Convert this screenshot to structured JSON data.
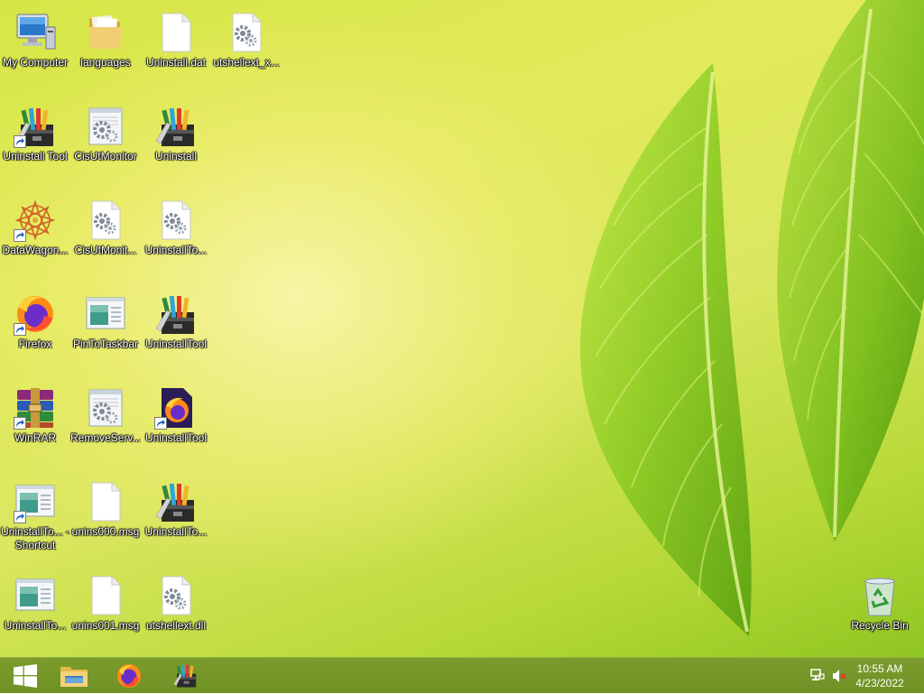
{
  "desktop_icons": [
    {
      "label": "My Computer",
      "icon": "computer-icon",
      "shortcut": false
    },
    {
      "label": "languages",
      "icon": "folder-icon",
      "shortcut": false
    },
    {
      "label": "Uninstall.dat",
      "icon": "file-icon",
      "shortcut": false
    },
    {
      "label": "utshellext_x...",
      "icon": "settings-file-icon",
      "shortcut": false
    },
    {
      "label": "Uninstall Tool",
      "icon": "uninstall-tool-icon",
      "shortcut": true
    },
    {
      "label": "CisUtMonitor",
      "icon": "config-file-icon",
      "shortcut": false
    },
    {
      "label": "Uninstall",
      "icon": "uninstall-tool-icon",
      "shortcut": false
    },
    {
      "label": "DataWagon...",
      "icon": "datawagon-icon",
      "shortcut": true
    },
    {
      "label": "CisUtMonit...",
      "icon": "settings-file-icon",
      "shortcut": false
    },
    {
      "label": "UninstallTo...",
      "icon": "settings-file-icon",
      "shortcut": false
    },
    {
      "label": "Firefox",
      "icon": "firefox-icon",
      "shortcut": true
    },
    {
      "label": "PinToTaskbar",
      "icon": "window-app-icon",
      "shortcut": false
    },
    {
      "label": "UninstallTool",
      "icon": "uninstall-tool-icon",
      "shortcut": false
    },
    {
      "label": "WinRAR",
      "icon": "winrar-icon",
      "shortcut": true
    },
    {
      "label": "RemoveServ...",
      "icon": "config-file-icon",
      "shortcut": false
    },
    {
      "label": "UninstallTool",
      "icon": "firefox-dark-icon",
      "shortcut": true
    },
    {
      "label": "UninstallTo... - Shortcut",
      "icon": "window-app-icon",
      "shortcut": true
    },
    {
      "label": "unins000.msg",
      "icon": "file-icon",
      "shortcut": false
    },
    {
      "label": "UninstallTo...",
      "icon": "uninstall-tool-icon",
      "shortcut": false
    },
    {
      "label": "UninstallTo...",
      "icon": "window-app-icon",
      "shortcut": false
    },
    {
      "label": "unins001.msg",
      "icon": "file-icon",
      "shortcut": false
    },
    {
      "label": "utshellext.dll",
      "icon": "settings-file-icon",
      "shortcut": false
    },
    {
      "label": "Recycle Bin",
      "icon": "recycle-bin-icon",
      "shortcut": false
    }
  ],
  "taskbar": {
    "start": "windows-logo-icon",
    "pinned": [
      "file-explorer-icon",
      "firefox-icon",
      "uninstall-tool-icon"
    ],
    "tray": [
      "network-icon",
      "volume-muted-icon"
    ],
    "time": "10:55 AM",
    "date": "4/23/2022"
  },
  "colors": {
    "taskbar": "#739528",
    "wallpaper_light": "#f6f3a6",
    "wallpaper_green": "#8fc621"
  }
}
